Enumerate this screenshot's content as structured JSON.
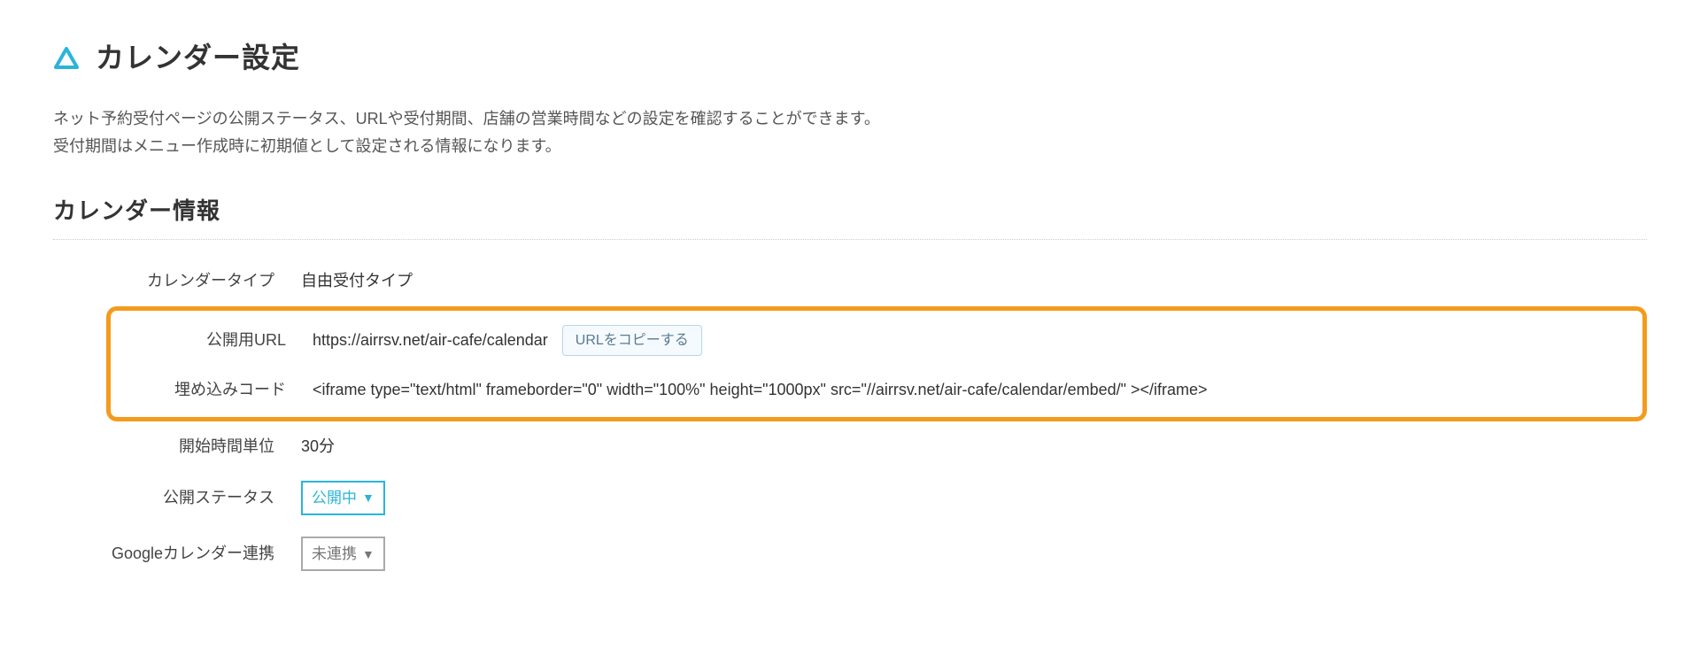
{
  "page": {
    "title": "カレンダー設定",
    "description_line1": "ネット予約受付ページの公開ステータス、URLや受付期間、店舗の営業時間などの設定を確認することができます。",
    "description_line2": "受付期間はメニュー作成時に初期値として設定される情報になります。"
  },
  "section": {
    "title": "カレンダー情報"
  },
  "fields": {
    "calendar_type": {
      "label": "カレンダータイプ",
      "value": "自由受付タイプ"
    },
    "public_url": {
      "label": "公開用URL",
      "value": "https://airrsv.net/air-cafe/calendar",
      "copy_button": "URLをコピーする"
    },
    "embed_code": {
      "label": "埋め込みコード",
      "value": "<iframe type=\"text/html\" frameborder=\"0\" width=\"100%\" height=\"1000px\" src=\"//airrsv.net/air-cafe/calendar/embed/\" ></iframe>"
    },
    "start_time_unit": {
      "label": "開始時間単位",
      "value": "30分"
    },
    "public_status": {
      "label": "公開ステータス",
      "value": "公開中"
    },
    "google_calendar": {
      "label": "Googleカレンダー連携",
      "value": "未連携"
    }
  }
}
